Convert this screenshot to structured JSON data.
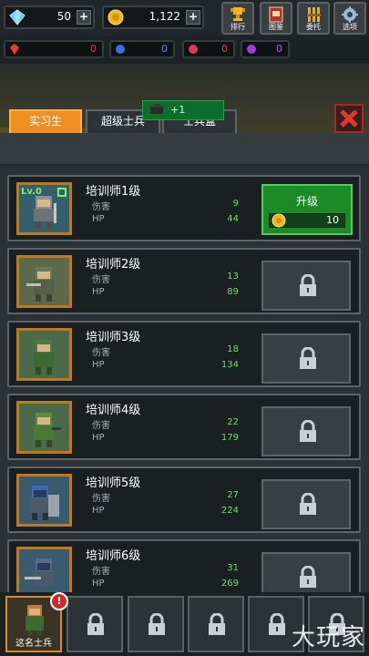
{
  "currency": {
    "gems": "50",
    "coins": "1,122"
  },
  "menu": [
    {
      "label": "排行",
      "icon": "trophy-icon"
    },
    {
      "label": "图鉴",
      "icon": "book-icon"
    },
    {
      "label": "委托",
      "icon": "banner-icon"
    },
    {
      "label": "选项",
      "icon": "gear-icon"
    }
  ],
  "gems": [
    {
      "color": "#e23b3b",
      "value": "0"
    },
    {
      "color": "#3d6de0",
      "value": "0"
    },
    {
      "color": "#e0385a",
      "value": "0"
    },
    {
      "color": "#9b3de0",
      "value": "0"
    }
  ],
  "tabs": [
    {
      "label": "实习生"
    },
    {
      "label": "超级士兵"
    },
    {
      "label": "士兵盒"
    }
  ],
  "toast": "+1",
  "stat_labels": {
    "damage": "伤害",
    "hp": "HP"
  },
  "upgrade": {
    "label": "升级",
    "cost": "10"
  },
  "trainers": [
    {
      "name": "培训师1级",
      "level": "Lv.0",
      "damage": "9",
      "hp": "44",
      "unlocked": true
    },
    {
      "name": "培训师2级",
      "damage": "13",
      "hp": "89",
      "unlocked": false
    },
    {
      "name": "培训师3级",
      "damage": "18",
      "hp": "134",
      "unlocked": false
    },
    {
      "name": "培训师4级",
      "damage": "22",
      "hp": "179",
      "unlocked": false
    },
    {
      "name": "培训师5级",
      "damage": "27",
      "hp": "224",
      "unlocked": false
    },
    {
      "name": "培训师6级",
      "damage": "31",
      "hp": "269",
      "unlocked": false
    }
  ],
  "bottom_slot": {
    "label": "这名士兵",
    "alert": "!"
  },
  "watermark": "大玩家"
}
